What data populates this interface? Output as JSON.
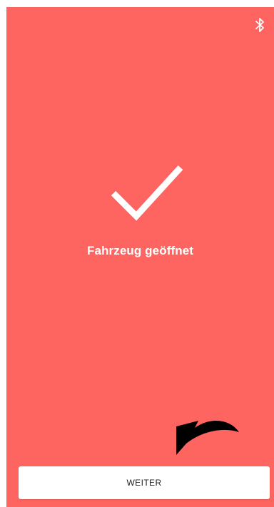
{
  "status": {
    "title": "Fahrzeug geöffnet"
  },
  "icons": {
    "bluetooth": "bluetooth-icon",
    "check": "checkmark-icon",
    "arrow": "curved-arrow-icon"
  },
  "actions": {
    "continue_label": "WEITER"
  },
  "colors": {
    "background": "#ff6560",
    "foreground": "#ffffff",
    "button_text": "#222222"
  }
}
